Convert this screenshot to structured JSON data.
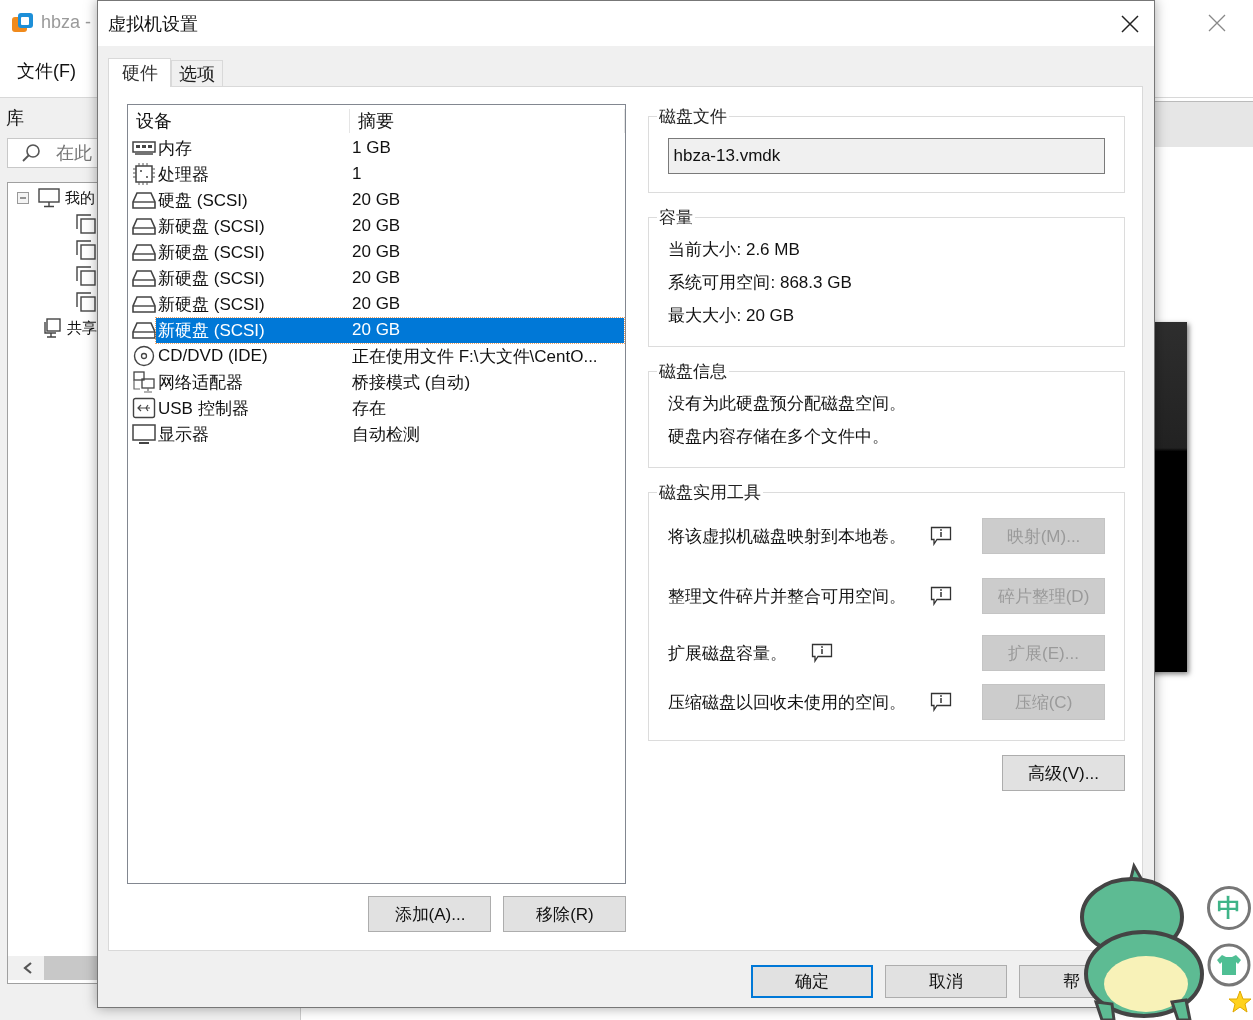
{
  "app": {
    "title": "hbza -",
    "menu": [
      "文件(F)"
    ],
    "library": {
      "title": "库",
      "search": {
        "placeholder": "在此"
      },
      "tree": [
        {
          "label": "我的",
          "kind": "computer",
          "expanded": true,
          "children": [
            {
              "kind": "vm"
            },
            {
              "kind": "vm"
            },
            {
              "kind": "vm"
            },
            {
              "kind": "vm"
            }
          ]
        },
        {
          "label": "共享",
          "kind": "shared"
        }
      ]
    }
  },
  "dialog": {
    "title": "虚拟机设置",
    "tabs": [
      {
        "label": "硬件",
        "selected": true
      },
      {
        "label": "选项",
        "selected": false
      }
    ],
    "devices": {
      "columns": [
        "设备",
        "摘要"
      ],
      "rows": [
        {
          "kind": "memory",
          "device": "内存",
          "summary": "1 GB",
          "selected": false
        },
        {
          "kind": "cpu",
          "device": "处理器",
          "summary": "1",
          "selected": false
        },
        {
          "kind": "disk",
          "device": "硬盘 (SCSI)",
          "summary": "20 GB",
          "selected": false
        },
        {
          "kind": "disk",
          "device": "新硬盘 (SCSI)",
          "summary": "20 GB",
          "selected": false
        },
        {
          "kind": "disk",
          "device": "新硬盘 (SCSI)",
          "summary": "20 GB",
          "selected": false
        },
        {
          "kind": "disk",
          "device": "新硬盘 (SCSI)",
          "summary": "20 GB",
          "selected": false
        },
        {
          "kind": "disk",
          "device": "新硬盘 (SCSI)",
          "summary": "20 GB",
          "selected": false
        },
        {
          "kind": "disk",
          "device": "新硬盘 (SCSI)",
          "summary": "20 GB",
          "selected": true
        },
        {
          "kind": "cdrom",
          "device": "CD/DVD (IDE)",
          "summary": "正在使用文件 F:\\大文件\\CentO...",
          "selected": false
        },
        {
          "kind": "network",
          "device": "网络适配器",
          "summary": "桥接模式 (自动)",
          "selected": false
        },
        {
          "kind": "usb",
          "device": "USB 控制器",
          "summary": "存在",
          "selected": false
        },
        {
          "kind": "display",
          "device": "显示器",
          "summary": "自动检测",
          "selected": false
        }
      ]
    },
    "device_buttons": [
      "添加(A)...",
      "移除(R)"
    ],
    "disk_file": {
      "title": "磁盘文件",
      "value": "hbza-13.vmdk"
    },
    "capacity": {
      "title": "容量",
      "lines": [
        "当前大小: 2.6 MB",
        "系统可用空间: 868.3 GB",
        "最大大小: 20 GB"
      ]
    },
    "disk_info": {
      "title": "磁盘信息",
      "lines": [
        "没有为此硬盘预分配磁盘空间。",
        "硬盘内容存储在多个文件中。"
      ]
    },
    "utilities": {
      "title": "磁盘实用工具",
      "rows": [
        {
          "label": "将该虚拟机磁盘映射到本地卷。",
          "info": true,
          "button": "映射(M)...",
          "disabled": true
        },
        {
          "label": "整理文件碎片并整合可用空间。",
          "info": true,
          "button": "碎片整理(D)",
          "disabled": true
        },
        {
          "label": "扩展磁盘容量。",
          "info": true,
          "button": "扩展(E)...",
          "disabled": true
        },
        {
          "label": "压缩磁盘以回收未使用的空间。",
          "info": true,
          "button": "压缩(C)",
          "disabled": true
        }
      ]
    },
    "advanced_button": "高级(V)...",
    "footer_buttons": [
      {
        "label": "确定",
        "default": true
      },
      {
        "label": "取消",
        "default": false
      },
      {
        "label": "帮",
        "default": false
      }
    ]
  },
  "ime": {
    "mode": "中"
  }
}
